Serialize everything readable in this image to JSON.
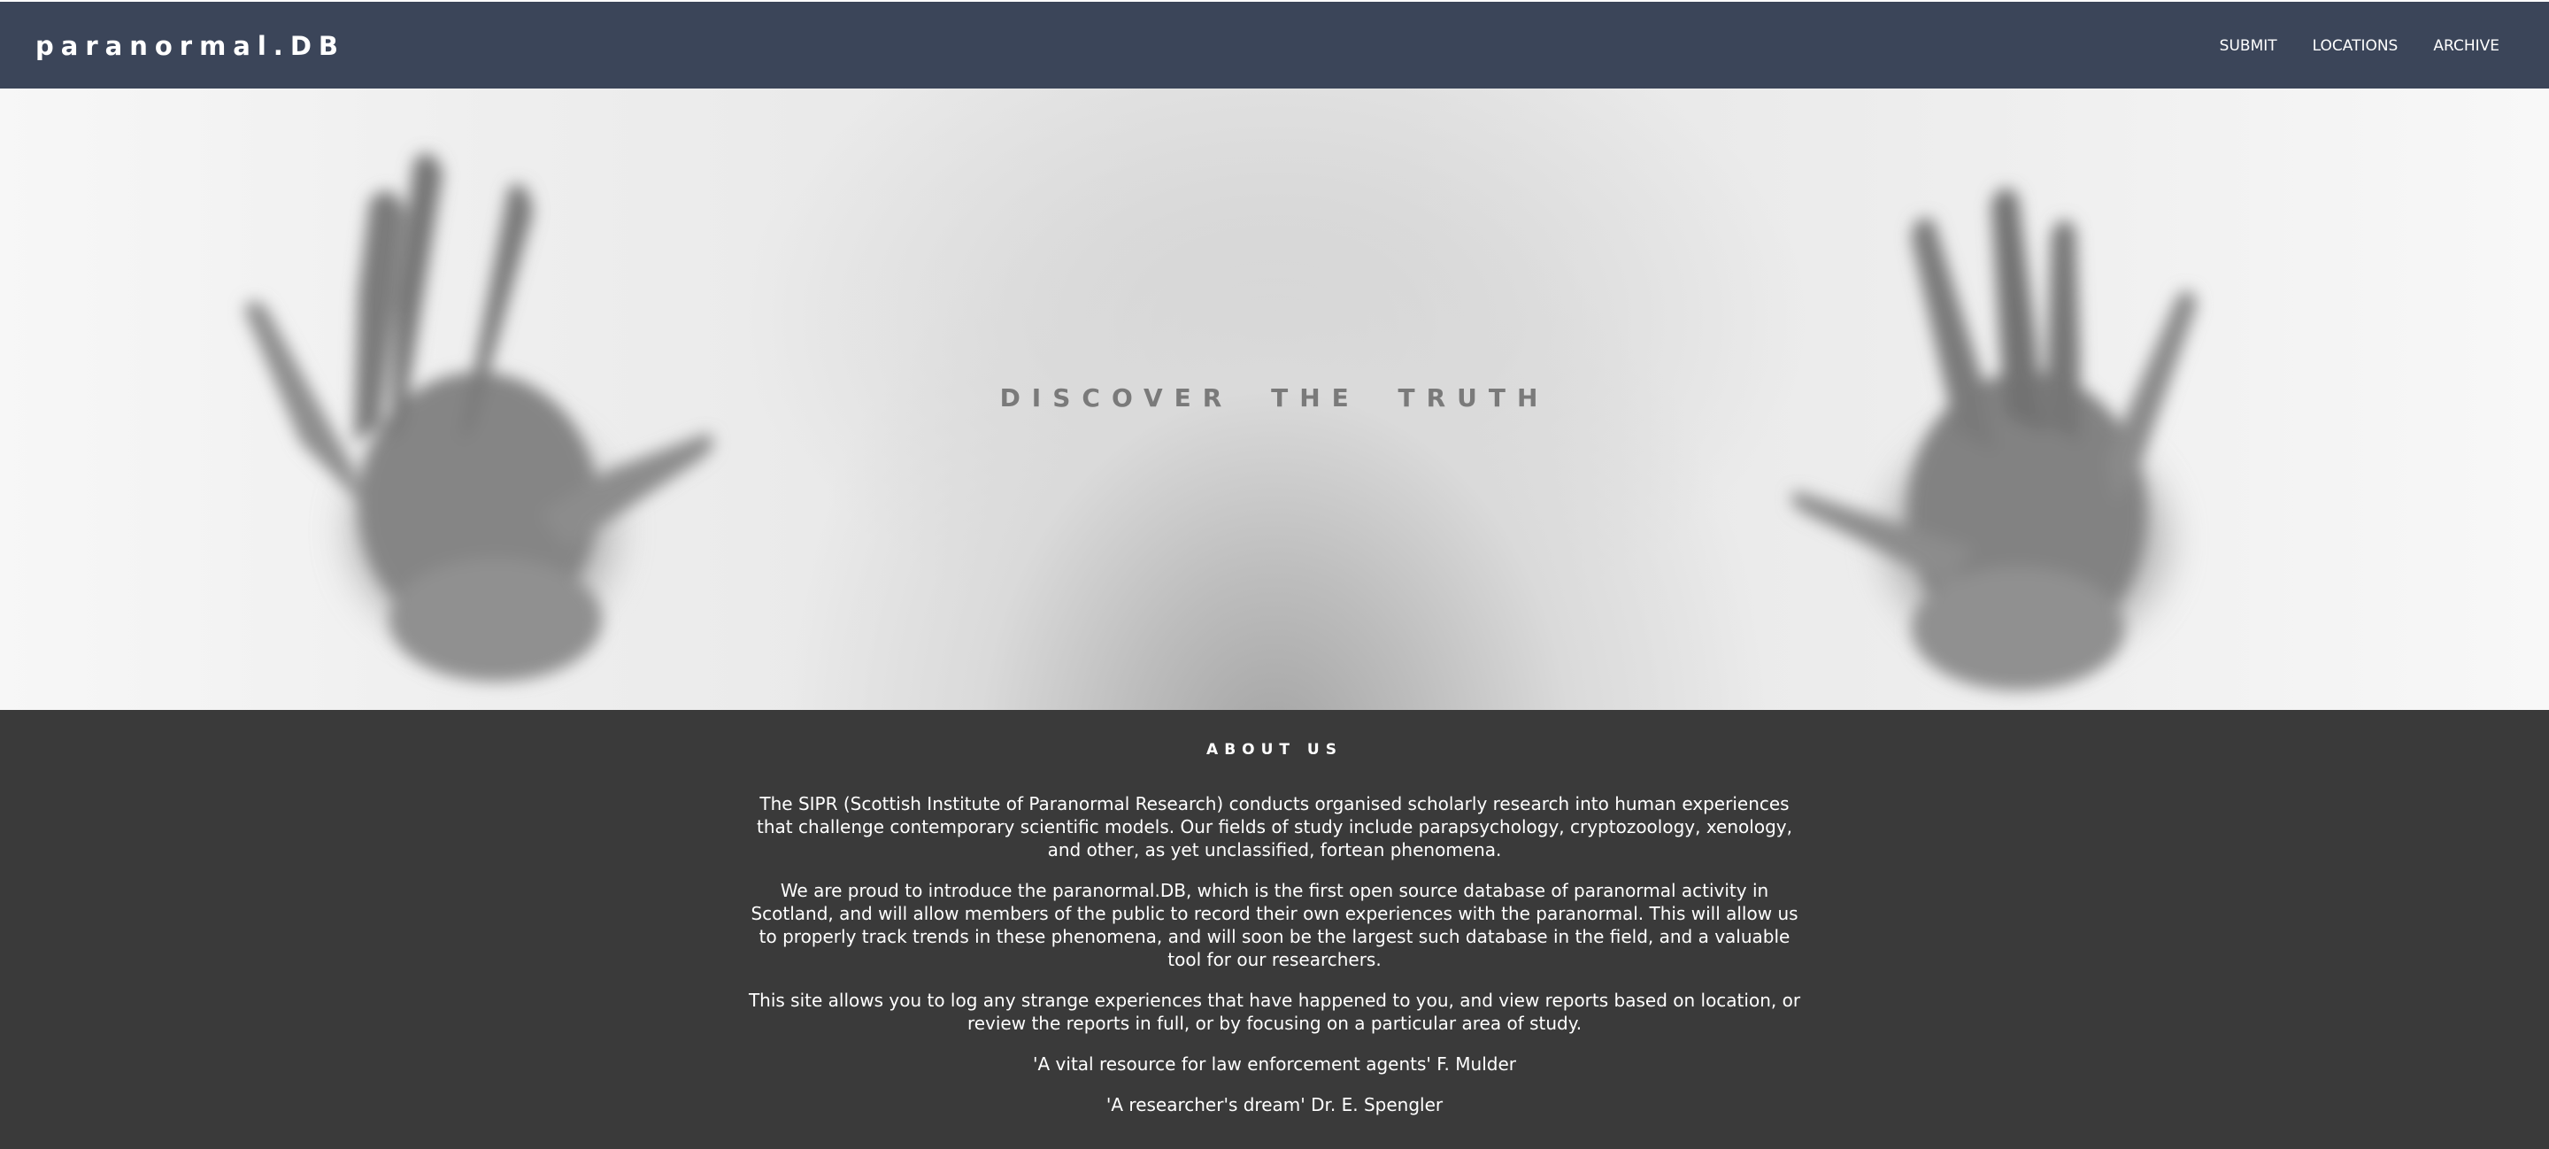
{
  "header": {
    "brand": "paranormal.DB",
    "nav": [
      {
        "label": "SUBMIT"
      },
      {
        "label": "LOCATIONS"
      },
      {
        "label": "ARCHIVE"
      }
    ]
  },
  "hero": {
    "title": "DISCOVER THE TRUTH",
    "image_description_icon": "hands-behind-glass-image"
  },
  "about": {
    "heading": "ABOUT US",
    "paragraphs": [
      "The SIPR (Scottish Institute of Paranormal Research) conducts organised scholarly research into human experiences that challenge contemporary scientific models. Our fields of study include parapsychology, cryptozoology, xenology, and other, as yet unclassified, fortean phenomena.",
      "We are proud to introduce the paranormal.DB, which is the first open source database of paranormal activity in Scotland, and will allow members of the public to record their own experiences with the paranormal. This will allow us to properly track trends in these phenomena, and will soon be the largest such database in the field, and a valuable tool for our researchers.",
      "This site allows you to log any strange experiences that have happened to you, and view reports based on location, or review the reports in full, or by focusing on a particular area of study."
    ],
    "quotes": [
      "'A vital resource for law enforcement agents' F. Mulder",
      "'A researcher's dream' Dr. E. Spengler"
    ]
  },
  "colors": {
    "navbar": "#3b4559",
    "about_bg": "#3a3a3a",
    "hero_text": "#7a7a7a"
  }
}
